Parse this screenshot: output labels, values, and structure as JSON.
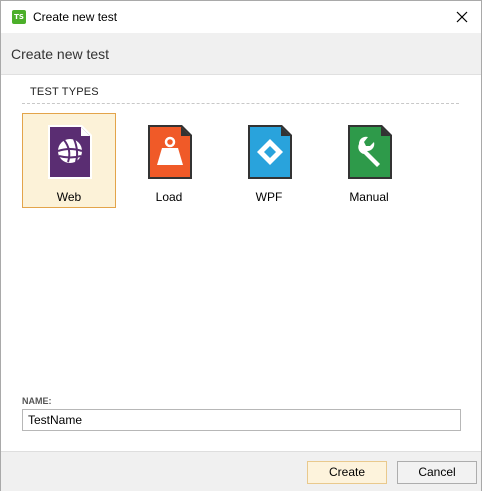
{
  "window": {
    "title": "Create new test",
    "app_icon_text": "TS",
    "app_icon_color": "#4caf2a"
  },
  "header": {
    "title": "Create new test"
  },
  "test_types": {
    "section_title": "TEST TYPES",
    "selected": "Web",
    "items": [
      {
        "label": "Web",
        "icon": "globe-icon",
        "color": "#5a2d72"
      },
      {
        "label": "Load",
        "icon": "weight-icon",
        "color": "#f05a28"
      },
      {
        "label": "WPF",
        "icon": "diamond-icon",
        "color": "#29a3dc"
      },
      {
        "label": "Manual",
        "icon": "wrench-icon",
        "color": "#2e9a4a"
      }
    ]
  },
  "name": {
    "label": "NAME:",
    "value": "TestName"
  },
  "footer": {
    "create_label": "Create",
    "cancel_label": "Cancel"
  }
}
